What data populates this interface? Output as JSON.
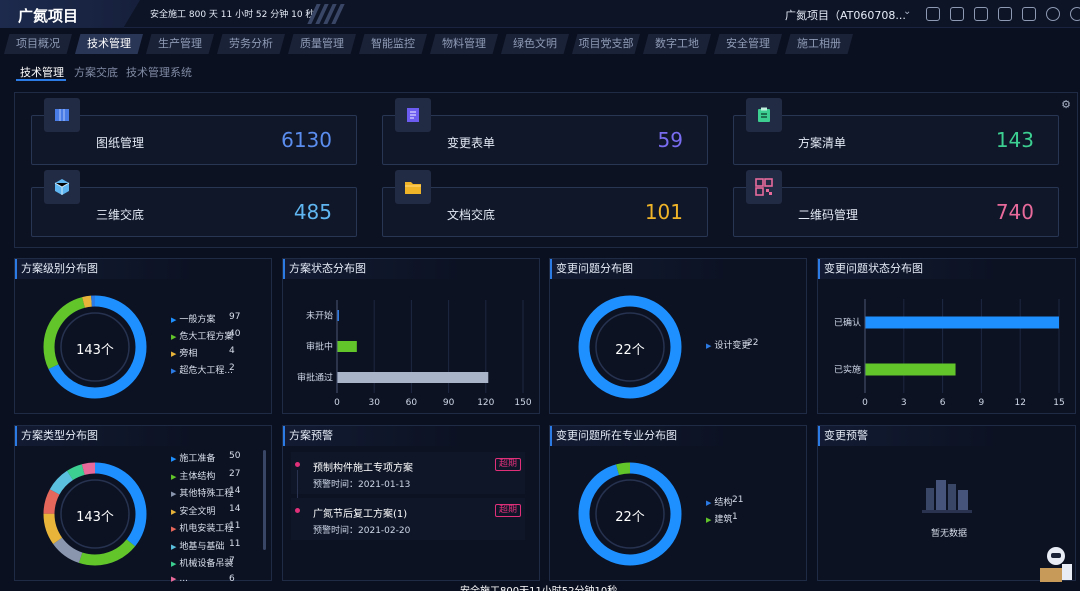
{
  "header": {
    "title": "广氮项目",
    "safety_text": "安全施工 800 天 11 小时 52 分钟 10 秒",
    "project_select": "广氮项目（AT060708..."
  },
  "module_tabs": [
    "项目概况",
    "技术管理",
    "生产管理",
    "劳务分析",
    "质量管理",
    "智能监控",
    "物料管理",
    "绿色文明",
    "项目党支部",
    "数字工地",
    "安全管理",
    "施工相册"
  ],
  "active_module": "技术管理",
  "sub_tabs": [
    "技术管理",
    "方案交底",
    "技术管理系统"
  ],
  "active_sub_tab": "技术管理",
  "stats": [
    {
      "label": "图纸管理",
      "value": "6130",
      "color": "#5b8def",
      "icon": "map-icon"
    },
    {
      "label": "变更表单",
      "value": "59",
      "color": "#7a6cf0",
      "icon": "form-icon"
    },
    {
      "label": "方案清单",
      "value": "143",
      "color": "#3ccf91",
      "icon": "clipboard-icon"
    },
    {
      "label": "三维交底",
      "value": "485",
      "color": "#5fb6f0",
      "icon": "cube-icon"
    },
    {
      "label": "文档交底",
      "value": "101",
      "color": "#f0b429",
      "icon": "folder-icon"
    },
    {
      "label": "二维码管理",
      "value": "740",
      "color": "#e76a9b",
      "icon": "qrcode-icon"
    }
  ],
  "panels": {
    "plan_level": {
      "title": "方案级别分布图",
      "center": "143个",
      "legend": [
        {
          "name": "一般方案",
          "value": "97",
          "color": "#1e90ff"
        },
        {
          "name": "危大工程方案",
          "value": "40",
          "color": "#62c52a"
        },
        {
          "name": "旁相",
          "value": "4",
          "color": "#e8b53a"
        },
        {
          "name": "超危大工程...",
          "value": "2",
          "color": "#2c7be5"
        }
      ]
    },
    "plan_status": {
      "title": "方案状态分布图"
    },
    "change_issue": {
      "title": "变更问题分布图",
      "center": "22个",
      "legend": [
        {
          "name": "设计变更",
          "value": "22",
          "color": "#2c7be5"
        }
      ]
    },
    "change_status": {
      "title": "变更问题状态分布图"
    },
    "plan_type": {
      "title": "方案类型分布图",
      "center": "143个",
      "legend": [
        {
          "name": "施工准备",
          "value": "50",
          "color": "#1e90ff"
        },
        {
          "name": "主体结构",
          "value": "27",
          "color": "#62c52a"
        },
        {
          "name": "其他特殊工程",
          "value": "14",
          "color": "#8a96ad"
        },
        {
          "name": "安全文明",
          "value": "14",
          "color": "#e8b53a"
        },
        {
          "name": "机电安装工程",
          "value": "11",
          "color": "#e5675b"
        },
        {
          "name": "地基与基础",
          "value": "11",
          "color": "#5bc0de"
        },
        {
          "name": "机械设备吊装",
          "value": "7",
          "color": "#3ccf91"
        },
        {
          "name": "...",
          "value": "6",
          "color": "#e76a9b"
        }
      ]
    },
    "plan_warning": {
      "title": "方案预警",
      "items": [
        {
          "name": "预制构件施工专项方案",
          "time_label": "预警时间：",
          "time": "2021-01-13",
          "badge": "超期"
        },
        {
          "name": "广氮节后复工方案(1)",
          "time_label": "预警时间：",
          "time": "2021-02-20",
          "badge": "超期"
        }
      ]
    },
    "change_major": {
      "title": "变更问题所在专业分布图",
      "center": "22个",
      "legend": [
        {
          "name": "结构",
          "value": "21",
          "color": "#2c7be5"
        },
        {
          "name": "建筑",
          "value": "1",
          "color": "#62c52a"
        }
      ]
    },
    "change_warning": {
      "title": "变更预警",
      "empty": "暂无数据"
    }
  },
  "bottom_safety": "安全施工800天11小时52分钟10秒",
  "chart_data": [
    {
      "type": "pie",
      "title": "方案级别分布图",
      "categories": [
        "一般方案",
        "危大工程方案",
        "旁相",
        "超危大工程..."
      ],
      "values": [
        97,
        40,
        4,
        2
      ],
      "colors": [
        "#1e90ff",
        "#62c52a",
        "#e8b53a",
        "#2c7be5"
      ]
    },
    {
      "type": "bar",
      "orientation": "horizontal",
      "title": "方案状态分布图",
      "categories": [
        "未开始",
        "审批中",
        "审批通过"
      ],
      "values": [
        1,
        16,
        122
      ],
      "colors": [
        "#2c7be5",
        "#62c52a",
        "#aab4c8"
      ],
      "xlim": [
        0,
        150
      ],
      "xticks": [
        "0",
        "30",
        "60",
        "90",
        "120",
        "150"
      ]
    },
    {
      "type": "pie",
      "title": "变更问题分布图",
      "categories": [
        "设计变更"
      ],
      "values": [
        22
      ],
      "colors": [
        "#1e90ff"
      ]
    },
    {
      "type": "bar",
      "orientation": "horizontal",
      "title": "变更问题状态分布图",
      "categories": [
        "已确认",
        "已实施"
      ],
      "values": [
        15,
        7
      ],
      "colors": [
        "#1e90ff",
        "#62c52a"
      ],
      "xlim": [
        0,
        15
      ],
      "xticks": [
        "0",
        "3",
        "6",
        "9",
        "12",
        "15"
      ]
    },
    {
      "type": "pie",
      "title": "方案类型分布图",
      "categories": [
        "施工准备",
        "主体结构",
        "其他特殊工程",
        "安全文明",
        "机电安装工程",
        "地基与基础",
        "机械设备吊装",
        "..."
      ],
      "values": [
        50,
        27,
        14,
        14,
        11,
        11,
        7,
        6
      ],
      "colors": [
        "#1e90ff",
        "#62c52a",
        "#8a96ad",
        "#e8b53a",
        "#e5675b",
        "#5bc0de",
        "#3ccf91",
        "#e76a9b"
      ]
    },
    {
      "type": "pie",
      "title": "变更问题所在专业分布图",
      "categories": [
        "结构",
        "建筑"
      ],
      "values": [
        21,
        1
      ],
      "colors": [
        "#1e90ff",
        "#62c52a"
      ]
    }
  ]
}
